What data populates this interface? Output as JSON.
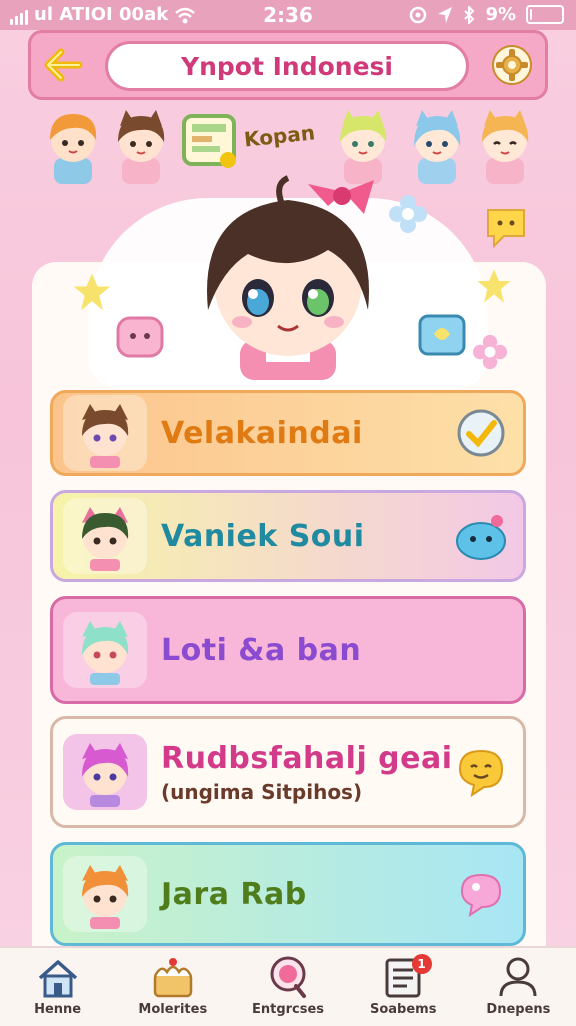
{
  "status": {
    "carrier": "ul ATIOI 00ak",
    "time": "2:36",
    "battery": "9%",
    "battery_level": 0.09
  },
  "header": {
    "title": "Ynpot Indonesi"
  },
  "strip": {
    "tag": "Kopan"
  },
  "colors": {
    "accent": "#d13a78",
    "header_bg": "#f5a9c6"
  },
  "options": [
    {
      "label": "Velakaindai",
      "sublabel": "",
      "trail_icon": "check-icon",
      "text_color": "#e07a12"
    },
    {
      "label": "Vaniek Soui",
      "sublabel": "",
      "trail_icon": "monster-icon",
      "text_color": "#1f8aa0"
    },
    {
      "label": "Loti &a ban",
      "sublabel": "",
      "trail_icon": "",
      "text_color": "#8a4bd1"
    },
    {
      "label": "Rudbsfahalj geai",
      "sublabel": "(ungima Sitpihos)",
      "trail_icon": "emoji-icon",
      "text_color": "#d33a8a"
    },
    {
      "label": "Jara Rab",
      "sublabel": "",
      "trail_icon": "speech-icon",
      "text_color": "#4f7d1c"
    }
  ],
  "nav": {
    "home": "Henne",
    "molerites": "Molerites",
    "entgrcses": "Entgrcses",
    "soabems": "Soabems",
    "dnepens": "Dnepens",
    "badge_count": "1"
  }
}
